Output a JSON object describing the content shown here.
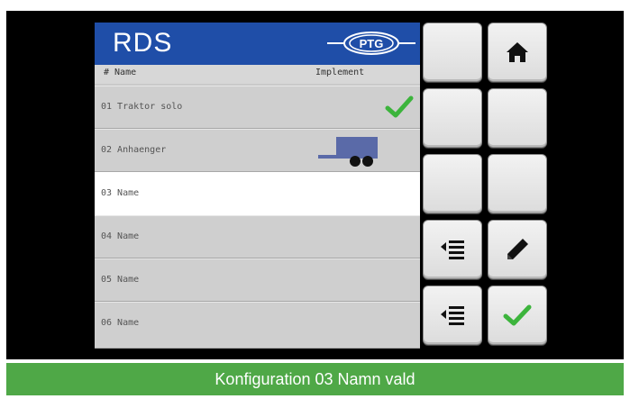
{
  "header": {
    "title": "RDS",
    "logo_text": "PTG",
    "col_number": "# Name",
    "col_implement": "Implement",
    "brand_color": "#1f4ea8"
  },
  "rows": [
    {
      "label": "01 Traktor solo",
      "icon": "checkmark-icon",
      "selected": false
    },
    {
      "label": "02 Anhaenger",
      "icon": "trailer-icon",
      "selected": false
    },
    {
      "label": "03 Name",
      "icon": null,
      "selected": true
    },
    {
      "label": "04 Name",
      "icon": null,
      "selected": false
    },
    {
      "label": "05 Name",
      "icon": null,
      "selected": false
    },
    {
      "label": "06 Name",
      "icon": null,
      "selected": false
    }
  ],
  "buttons": [
    {
      "name": "softkey-blank-1",
      "icon": null
    },
    {
      "name": "home-button",
      "icon": "home-icon"
    },
    {
      "name": "softkey-blank-2",
      "icon": null
    },
    {
      "name": "softkey-blank-3",
      "icon": null
    },
    {
      "name": "softkey-blank-4",
      "icon": null
    },
    {
      "name": "softkey-blank-5",
      "icon": null
    },
    {
      "name": "list-up-button",
      "icon": "list-up-icon"
    },
    {
      "name": "edit-button",
      "icon": "pencil-icon"
    },
    {
      "name": "list-down-button",
      "icon": "list-down-icon"
    },
    {
      "name": "confirm-button",
      "icon": "checkmark-icon"
    }
  ],
  "status": {
    "text": "Konfiguration 03 Namn vald",
    "color": "#4fa847"
  },
  "colors": {
    "check_green": "#3cb43c",
    "trailer_blue": "#5a6aa8"
  }
}
